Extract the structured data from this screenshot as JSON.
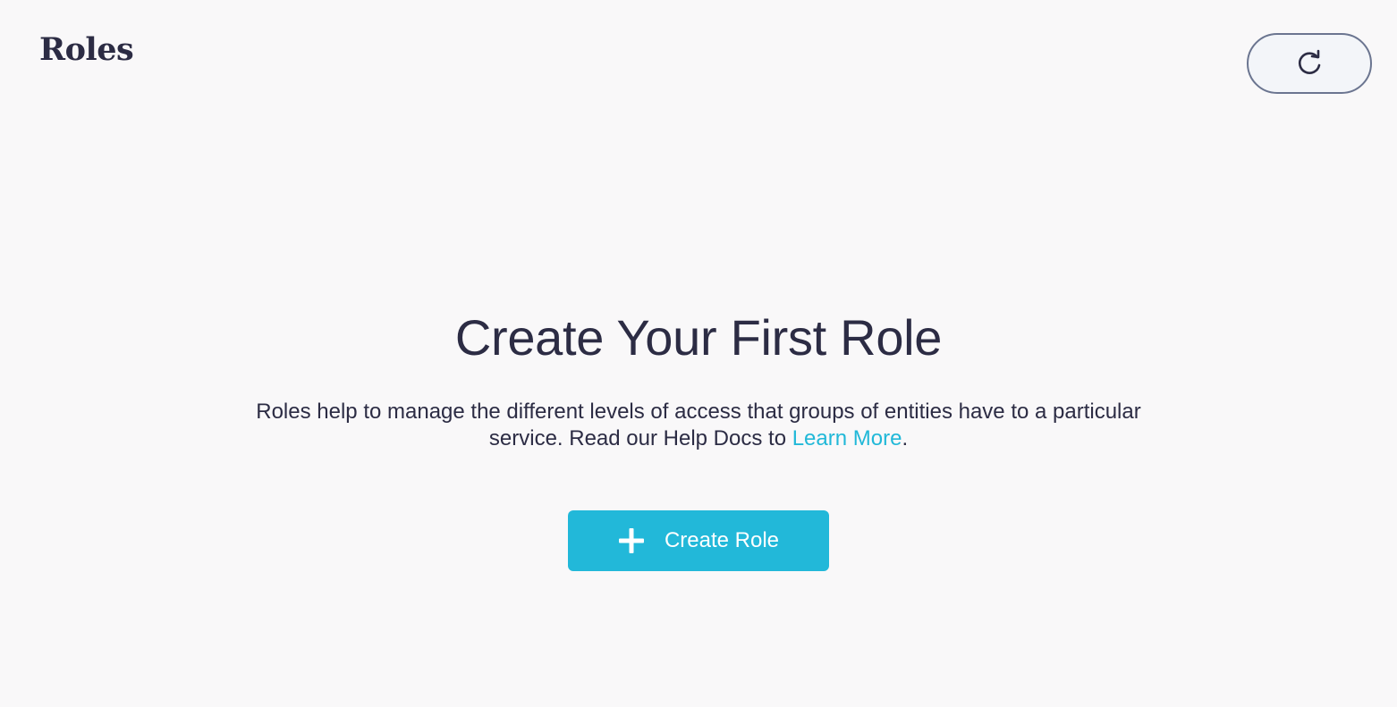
{
  "header": {
    "title": "Roles",
    "refresh_icon": "refresh-icon"
  },
  "empty_state": {
    "heading": "Create Your First Role",
    "description_prefix": "Roles help to manage the different levels of access that groups of entities have to a particular service. Read our Help Docs to ",
    "link_label": "Learn More",
    "description_suffix": ".",
    "button_label": "Create Role",
    "button_icon": "plus-icon"
  },
  "colors": {
    "background": "#f9f8f9",
    "text": "#2c2c44",
    "accent": "#22b8d9",
    "link": "#21b8d8",
    "refresh_border": "#6b7590"
  }
}
